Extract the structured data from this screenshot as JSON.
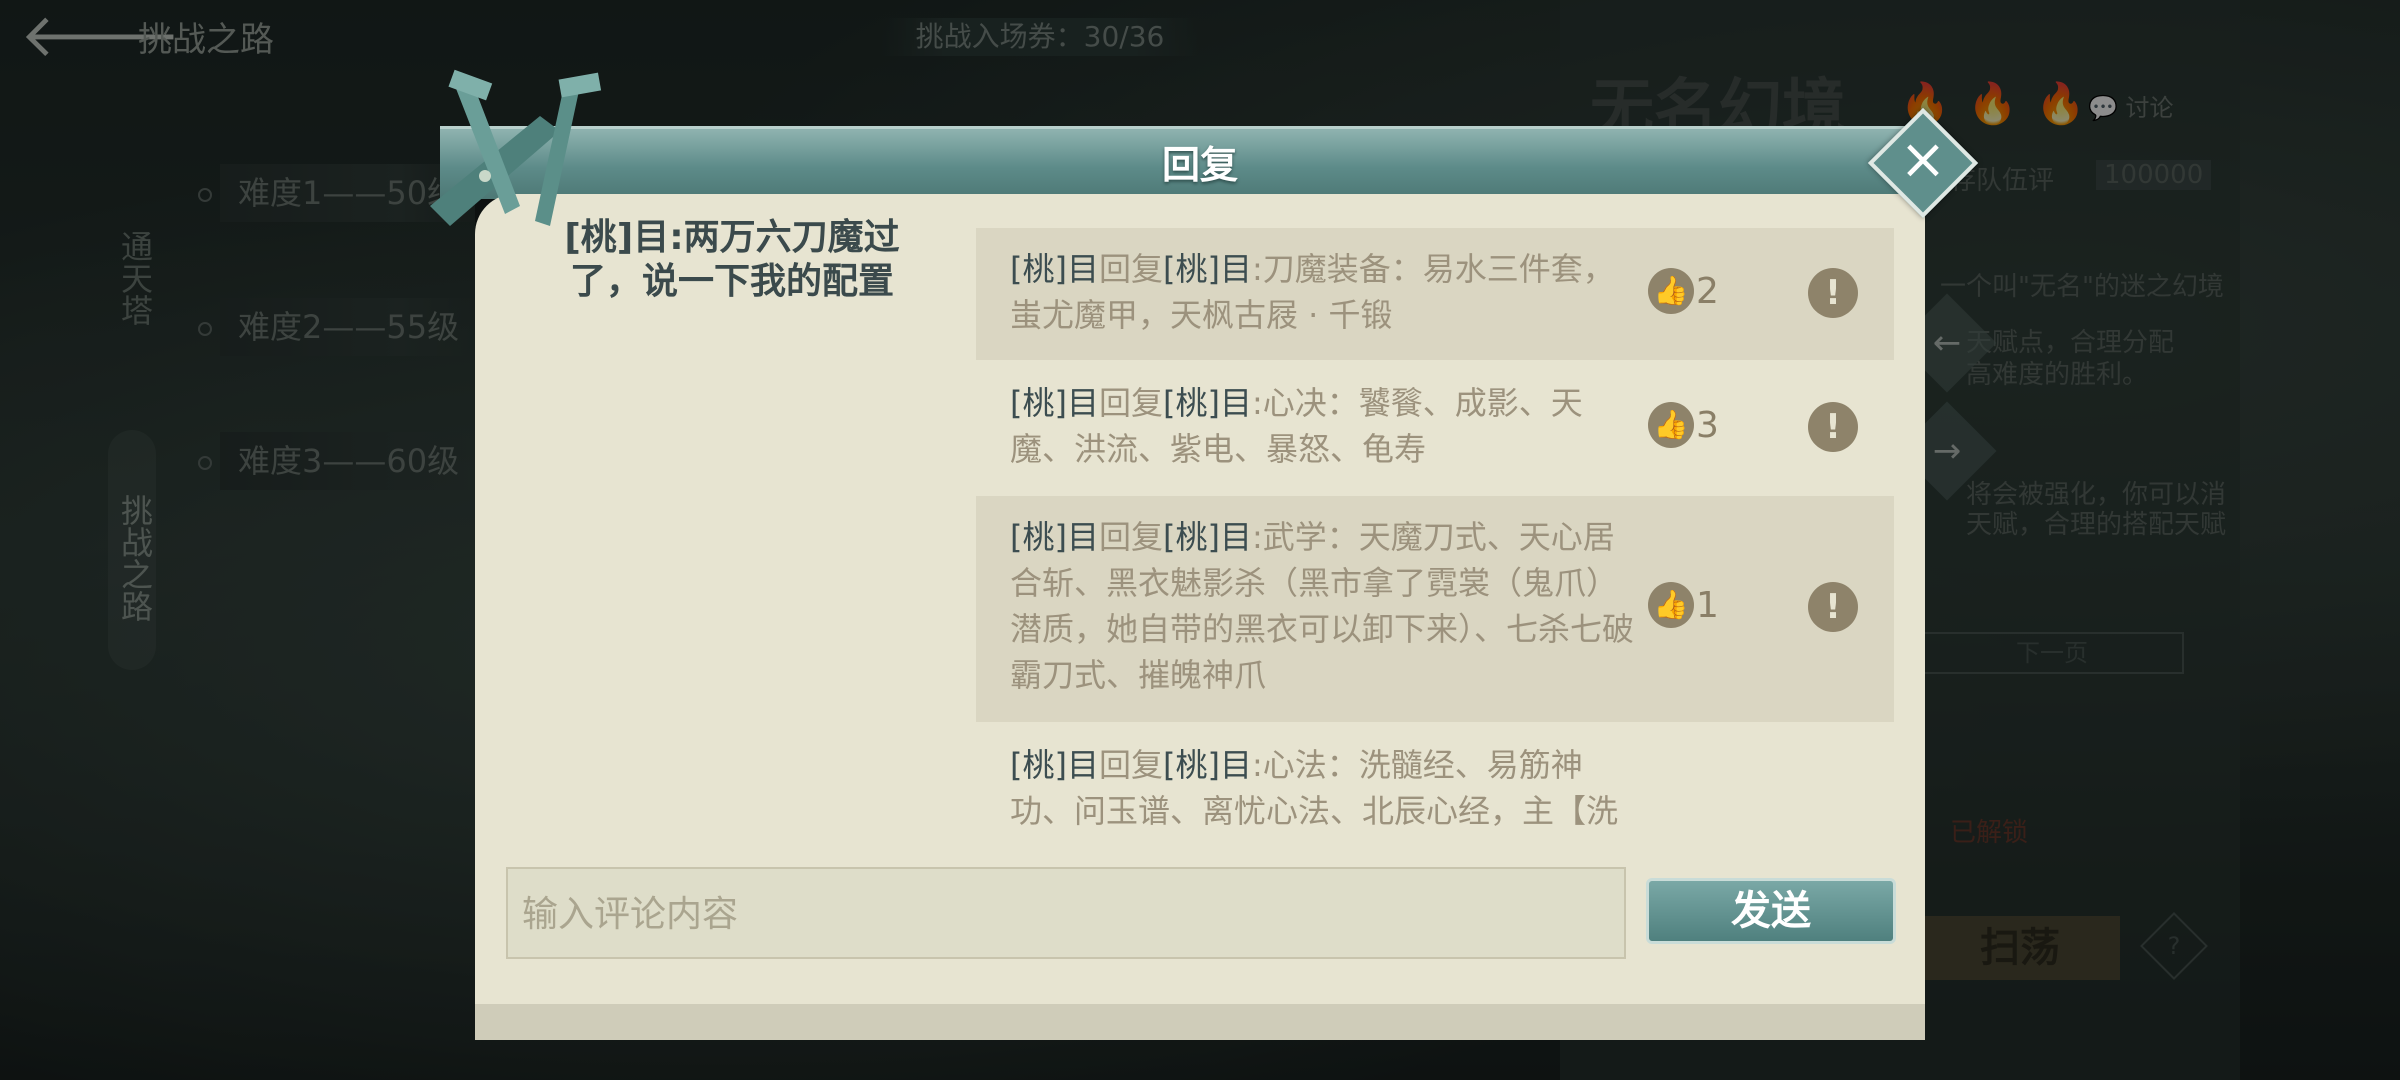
{
  "background": {
    "back_icon": "arrow-left",
    "top_title": "挑战之路",
    "ticket": "挑战入场券：30/36",
    "side_tab_1": "通天塔",
    "side_tab_2": "挑战之路",
    "difficulties": [
      "难度1——50级",
      "难度2——55级",
      "难度3——60级"
    ],
    "right": {
      "title": "无名幻境",
      "discuss": "讨论",
      "rank_label": "存队伍评",
      "rank_value": "100000",
      "desc_1": "一个叫\"无名\"的迷之幻境",
      "desc_2": "天赋点，合理分配",
      "desc_3": "高难度的胜利。",
      "desc_4": "将会被强化，你可以消",
      "desc_5": "天赋，合理的搭配天赋",
      "next_page": "下一页",
      "unlocked": "已解锁",
      "sweep": "扫荡",
      "help": "?"
    }
  },
  "dialog": {
    "title": "回复",
    "close_icon": "close-x",
    "original_post": "[桃]目:两万六刀魔过了，说一下我的配置",
    "replies": [
      {
        "user": "[桃]目",
        "verb": "回复",
        "target": "[桃]目",
        "text": ":刀魔装备：易水三件套，蚩尤魔甲，天枫古屐 · 千锻",
        "likes": "2"
      },
      {
        "user": "[桃]目",
        "verb": "回复",
        "target": "[桃]目",
        "text": ":心决：饕餮、成影、天魔、洪流、紫电、暴怒、龟寿",
        "likes": "3"
      },
      {
        "user": "[桃]目",
        "verb": "回复",
        "target": "[桃]目",
        "text": ":武学：天魔刀式、天心居合斩、黑衣魅影杀（黑市拿了霓裳（鬼爪）潜质，她自带的黑衣可以卸下来）、七杀七破霸刀式、摧魄神爪",
        "likes": "1"
      },
      {
        "user": "[桃]目",
        "verb": "回复",
        "target": "[桃]目",
        "text": ":心法：洗髓经、易筋神功、问玉谱、离忧心法、北辰心经，主【洗髓",
        "likes": ""
      }
    ],
    "input_placeholder": "输入评论内容",
    "send_label": "发送"
  },
  "colors": {
    "dialog_bg": "#e7e4d1",
    "header_teal": "#5d8b89",
    "username": "#3c4d50",
    "reply_text": "#9c927d",
    "icon_brown": "#8e836a"
  }
}
